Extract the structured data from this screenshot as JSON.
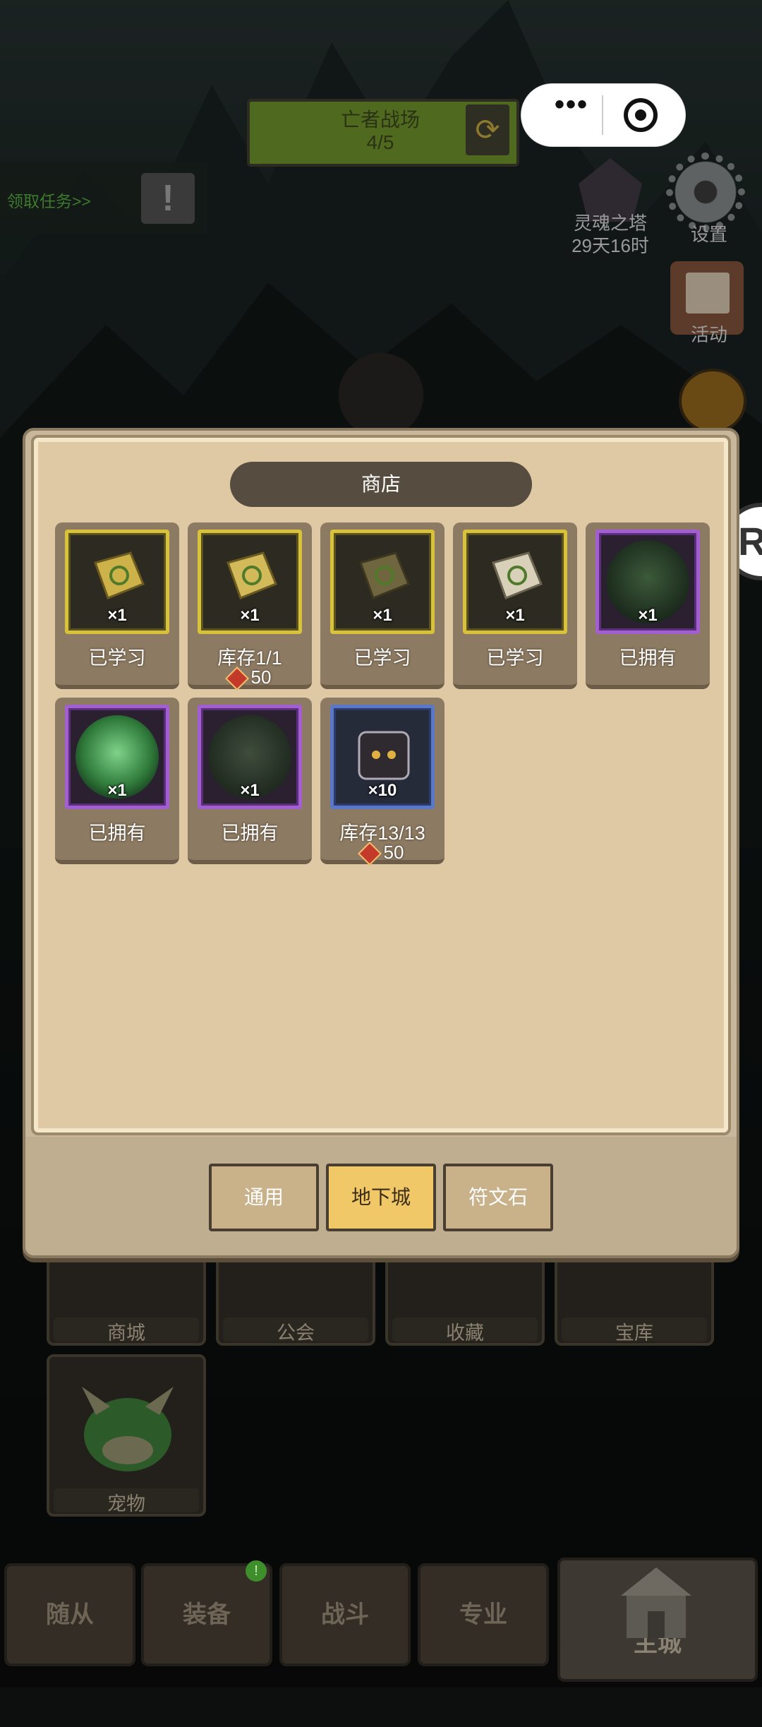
{
  "top": {
    "quest_link": "领取任务>>",
    "quest_icon": "!",
    "battle": {
      "title": "亡者战场",
      "progress": "4/5"
    },
    "capsule": {
      "more": "•••",
      "close_icon": "target-close-icon"
    },
    "tower": {
      "label": "灵魂之塔",
      "timer": "29天16时"
    },
    "settings_label": "设置",
    "activity_label": "活动",
    "edge_button": "R"
  },
  "shop": {
    "title": "商店",
    "items": [
      {
        "icon": "gold-skill-book-icon",
        "qty": "×1",
        "status": "已学习",
        "price": ""
      },
      {
        "icon": "gold-skill-book-icon",
        "qty": "×1",
        "status": "库存1/1",
        "price": "50"
      },
      {
        "icon": "dark-skill-book-icon",
        "qty": "×1",
        "status": "已学习",
        "price": ""
      },
      {
        "icon": "silver-skill-book-icon",
        "qty": "×1",
        "status": "已学习",
        "price": ""
      },
      {
        "icon": "shadow-beast-pet-icon",
        "qty": "×1",
        "status": "已拥有",
        "price": ""
      },
      {
        "icon": "green-dragon-pet-icon",
        "qty": "×1",
        "status": "已拥有",
        "price": ""
      },
      {
        "icon": "stone-golem-pet-icon",
        "qty": "×1",
        "status": "已拥有",
        "price": ""
      },
      {
        "icon": "demon-helm-chest-icon",
        "qty": "×10",
        "status": "库存13/13",
        "price": "50"
      }
    ],
    "tabs": [
      "通用",
      "地下城",
      "符文石"
    ],
    "active_tab": "地下城"
  },
  "menu_grid": [
    "商城",
    "公会",
    "收藏",
    "宝库",
    "宠物"
  ],
  "bottom_nav": [
    "随从",
    "装备",
    "战斗",
    "专业",
    "主城"
  ],
  "bottom_nav_badge": "!",
  "colors": {
    "panel": "#dfc9a4",
    "active_tab": "#f0c867",
    "gold_frame": "#d7c23a",
    "purple_frame": "#a35ed2",
    "blue_frame": "#5b78c8"
  }
}
